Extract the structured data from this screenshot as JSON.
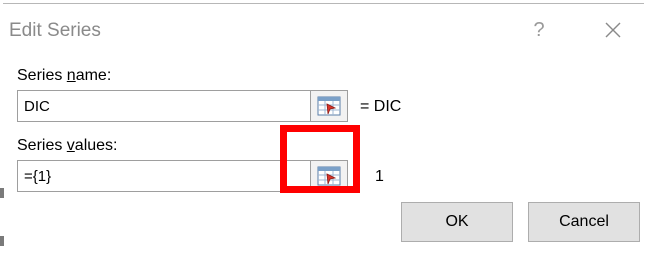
{
  "dialog": {
    "title": "Edit Series",
    "help_glyph": "?",
    "close_icon": "close-icon"
  },
  "series_name": {
    "label_before": "Series ",
    "label_accel": "n",
    "label_after": "ame:",
    "value": "DIC",
    "result": "= DIC",
    "ref_icon": "range-select-icon"
  },
  "series_values": {
    "label_before": "Series ",
    "label_accel": "v",
    "label_after": "alues:",
    "value": "={1}",
    "result": "1",
    "ref_icon": "range-select-icon"
  },
  "buttons": {
    "ok": "OK",
    "cancel": "Cancel"
  },
  "colors": {
    "highlight": "#ff0000",
    "title_text": "#8a8a8a"
  }
}
